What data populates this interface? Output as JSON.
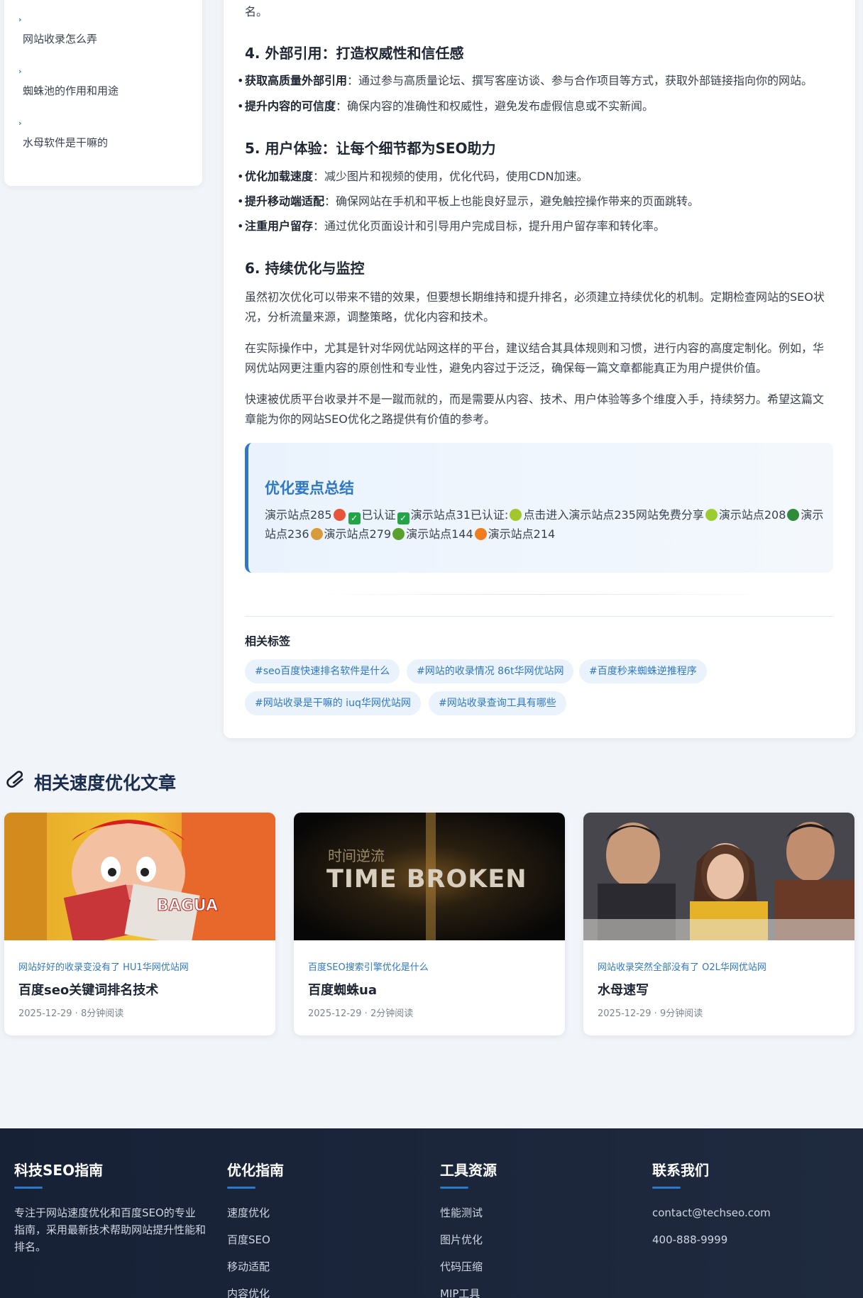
{
  "sidebar": {
    "items": [
      {
        "label": "网站收录怎么弄"
      },
      {
        "label": "蜘蛛池的作用和用途"
      },
      {
        "label": "水母软件是干嘛的"
      }
    ]
  },
  "article": {
    "intro_tail": "名。",
    "sec4": {
      "title": "4. 外部引用：打造权威性和信任感",
      "items": [
        {
          "strong": "获取高质量外部引用",
          "text": "：通过参与高质量论坛、撰写客座访谈、参与合作项目等方式，获取外部链接指向你的网站。"
        },
        {
          "strong": "提升内容的可信度",
          "text": "：确保内容的准确性和权威性，避免发布虚假信息或不实新闻。"
        }
      ]
    },
    "sec5": {
      "title": "5. 用户体验：让每个细节都为SEO助力",
      "items": [
        {
          "strong": "优化加载速度",
          "text": "：减少图片和视频的使用，优化代码，使用CDN加速。"
        },
        {
          "strong": "提升移动端适配",
          "text": "：确保网站在手机和平板上也能良好显示，避免触控操作带来的页面跳转。"
        },
        {
          "strong": "注重用户留存",
          "text": "：通过优化页面设计和引导用户完成目标，提升用户留存率和转化率。"
        }
      ]
    },
    "sec6": {
      "title": "6. 持续优化与监控",
      "p1": "虽然初次优化可以带来不错的效果，但要想长期维持和提升排名，必须建立持续优化的机制。定期检查网站的SEO状况，分析流量来源，调整策略，优化内容和技术。",
      "p2": "在实际操作中，尤其是针对华网优站网这样的平台，建议结合其具体规则和习惯，进行内容的高度定制化。例如，华网优站网更注重内容的原创性和专业性，避免内容过于泛泛，确保每一篇文章都能真正为用户提供价值。",
      "p3": "快速被优质平台收录并不是一蹴而就的，而是需要从内容、技术、用户体验等多个维度入手，持续努力。希望这篇文章能为你的网站SEO优化之路提供有价值的参考。"
    },
    "summary": {
      "title": "优化要点总结",
      "segments": [
        {
          "text": "演示站点285",
          "icon": "watermelon-icon",
          "color": "#e8543a"
        },
        {
          "text": "",
          "icon": "check-mark-icon",
          "color": "#22a447"
        },
        {
          "text": "已认证",
          "icon": "check-mark-icon",
          "color": "#22a447"
        },
        {
          "text": "演示站点31已认证:",
          "icon": "pear-icon",
          "color": "#a3c62b"
        },
        {
          "text": "点击进入演示站点235网站免费分享",
          "icon": "green-apple-icon",
          "color": "#9ccc2e"
        },
        {
          "text": "演示站点208",
          "icon": "clover-icon",
          "color": "#2e8b3a"
        },
        {
          "text": "演示站点236",
          "icon": "peanut-icon",
          "color": "#d99a3a"
        },
        {
          "text": "演示站点279",
          "icon": "cucumber-icon",
          "color": "#5aa02c"
        },
        {
          "text": "演示站点144",
          "icon": "orange-icon",
          "color": "#f07c1e"
        },
        {
          "text": "演示站点214",
          "icon": "",
          "color": ""
        }
      ]
    },
    "tags_title": "相关标签",
    "tags": [
      "#seo百度快速排名软件是什么",
      "#网站的收录情况 86t华网优站网",
      "#百度秒来蜘蛛逆推程序",
      "#网站收录是干嘛的 iuq华网优站网",
      "#网站收录查询工具有哪些"
    ]
  },
  "related": {
    "title": "相关速度优化文章",
    "cards": [
      {
        "category": "网站好好的收录变没有了 HU1华网优站网",
        "title": "百度seo关键词排名技术",
        "meta": "2025-12-29 · 8分钟阅读"
      },
      {
        "category": "百度SEO搜索引擎优化是什么",
        "title": "百度蜘蛛ua",
        "meta": "2025-12-29 · 2分钟阅读",
        "thumb_text_top": "时间逆流",
        "thumb_text_main": "TIME BROKEN"
      },
      {
        "category": "网站收录突然全部没有了 O2L华网优站网",
        "title": "水母速写",
        "meta": "2025-12-29 · 9分钟阅读"
      }
    ]
  },
  "footer": {
    "col1": {
      "title": "科技SEO指南",
      "text": "专注于网站速度优化和百度SEO的专业指南，采用最新技术帮助网站提升性能和排名。"
    },
    "col2": {
      "title": "优化指南",
      "links": [
        "速度优化",
        "百度SEO",
        "移动适配",
        "内容优化"
      ]
    },
    "col3": {
      "title": "工具资源",
      "links": [
        "性能测试",
        "图片优化",
        "代码压缩",
        "MIP工具"
      ]
    },
    "col4": {
      "title": "联系我们",
      "links": [
        "contact@techseo.com",
        "400-888-9999"
      ]
    }
  }
}
